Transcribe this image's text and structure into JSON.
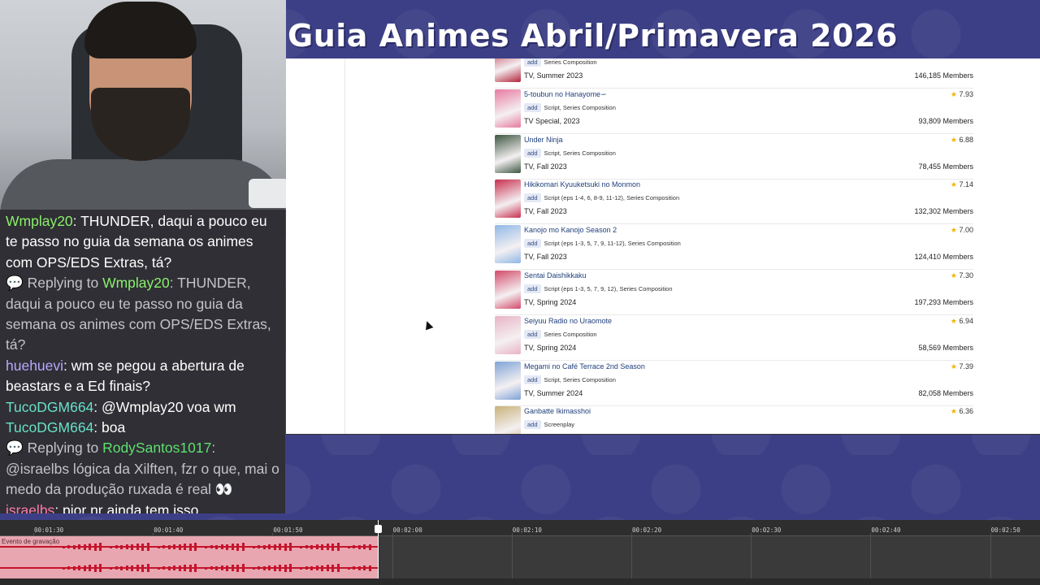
{
  "overlay": {
    "title": "Guia Animes Abril/Primavera 2026"
  },
  "chat": {
    "messages": [
      {
        "type": "msg",
        "user": "Wmplay20",
        "color": "#8bf06a",
        "text": ": THUNDER, daqui a pouco eu te passo no guia da semana os animes com OPS/EDS Extras, tá?"
      },
      {
        "type": "reply",
        "prefix": "Replying to ",
        "user": "Wmplay20",
        "color": "#8bf06a",
        "text": ": THUNDER, daqui a pouco eu te passo no guia da semana os animes com OPS/EDS Extras, tá?"
      },
      {
        "type": "msg",
        "user": "huehuevi",
        "color": "#b6a8ff",
        "text": ": wm se pegou a abertura de beastars e a Ed finais?"
      },
      {
        "type": "msg",
        "user": "TucoDGM664",
        "color": "#69e0c8",
        "text": ": @Wmplay20 voa wm"
      },
      {
        "type": "msg",
        "user": "TucoDGM664",
        "color": "#69e0c8",
        "text": ": boa"
      },
      {
        "type": "reply",
        "prefix": "Replying to ",
        "user": "RodySantos1017",
        "color": "#5fe06f",
        "text": ": @israelbs lógica da Xilften, fzr o que, mai o medo da produção ruxada é real 👀"
      },
      {
        "type": "msg",
        "user": "israelbs",
        "color": "#ff7aa8",
        "text": ": pior nr ainda tem isso"
      }
    ]
  },
  "browser": {
    "entries": [
      {
        "name": "",
        "roles": "Series Composition",
        "type": "TV, Summer 2023",
        "score": "",
        "members": "146,185 Members",
        "thumb": "#b2243a"
      },
      {
        "name": "5-toubun no Hanayome∽",
        "roles": "Script, Series Composition",
        "type": "TV Special, 2023",
        "score": "7.93",
        "members": "93,809 Members",
        "thumb": "#e77aa0"
      },
      {
        "name": "Under Ninja",
        "roles": "Script, Series Composition",
        "type": "TV, Fall 2023",
        "score": "6.88",
        "members": "78,455 Members",
        "thumb": "#3d5640"
      },
      {
        "name": "Hikikomari Kyuuketsuki no Monmon",
        "roles": "Script (eps 1-4, 6, 8-9, 11-12), Series Composition",
        "type": "TV, Fall 2023",
        "score": "7.14",
        "members": "132,302 Members",
        "thumb": "#c8304f"
      },
      {
        "name": "Kanojo mo Kanojo Season 2",
        "roles": "Script (eps 1-3, 5, 7, 9, 11-12), Series Composition",
        "type": "TV, Fall 2023",
        "score": "7.00",
        "members": "124,410 Members",
        "thumb": "#8fb7e6"
      },
      {
        "name": "Sentai Daishikkaku",
        "roles": "Script (eps 1-3, 5, 7, 9, 12), Series Composition",
        "type": "TV, Spring 2024",
        "score": "7.30",
        "members": "197,293 Members",
        "thumb": "#d34a6a"
      },
      {
        "name": "Seiyuu Radio no Uraomote",
        "roles": "Series Composition",
        "type": "TV, Spring 2024",
        "score": "6.94",
        "members": "58,569 Members",
        "thumb": "#e8b4c4"
      },
      {
        "name": "Megami no Café Terrace 2nd Season",
        "roles": "Script, Series Composition",
        "type": "TV, Summer 2024",
        "score": "7.39",
        "members": "82,058 Members",
        "thumb": "#7fa3d6"
      },
      {
        "name": "Ganbatte Ikimasshoi",
        "roles": "Screenplay",
        "type": "",
        "score": "6.36",
        "members": "",
        "thumb": "#c9b27a"
      }
    ],
    "add_label": "add"
  },
  "timeline": {
    "clip_label": "Evento de gravação",
    "ticks": [
      "00:01:30",
      "00:01:40",
      "00:01:50",
      "00:02:00",
      "00:02:10",
      "00:02:20",
      "00:02:30",
      "00:02:40",
      "00:02:50"
    ]
  }
}
